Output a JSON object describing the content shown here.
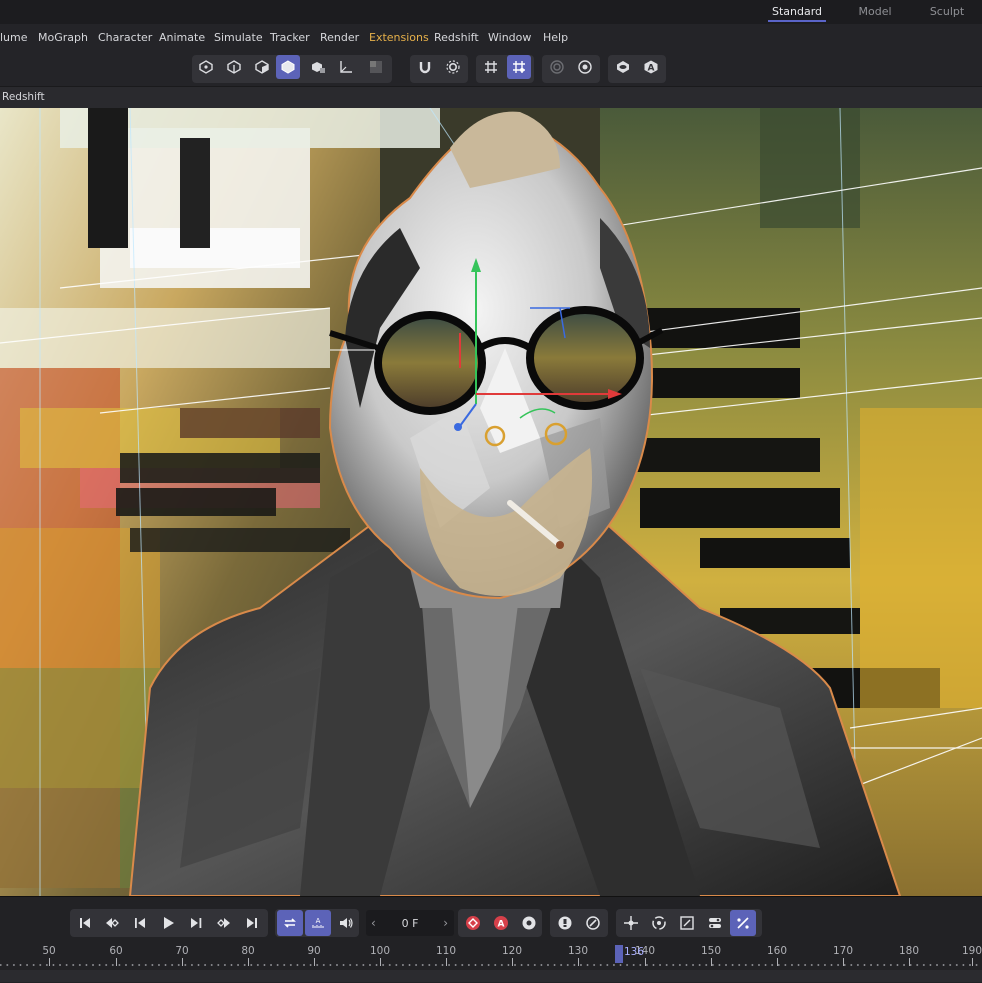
{
  "layouts": [
    "Standard",
    "Model",
    "Sculpt"
  ],
  "menu": [
    "lume",
    "MoGraph",
    "Character",
    "Animate",
    "Simulate",
    "Tracker",
    "Render",
    "Extensions",
    "Redshift",
    "Window",
    "Help"
  ],
  "toolbar_icons": [
    "null-object-icon",
    "spline-pen-icon",
    "cube-icon",
    "model-mode-icon",
    "object-mode-icon",
    "axis-icon",
    "render-region-icon",
    "magnet-icon",
    "gear-pin-icon",
    "grid-icon",
    "snap-grid-icon",
    "target-icon",
    "render-settings-icon",
    "eye-icon",
    "text-a-icon"
  ],
  "viewport": {
    "label": "Redshift"
  },
  "timeline": {
    "frame_value": "0 F",
    "ruler_ticks": [
      "50",
      "60",
      "70",
      "80",
      "90",
      "100",
      "110",
      "120",
      "130",
      "140",
      "150",
      "160",
      "170",
      "180",
      "190"
    ],
    "current_frame": "136",
    "buttons": [
      "go-to-start-icon",
      "prev-key-icon",
      "prev-frame-icon",
      "play-icon",
      "next-frame-icon",
      "next-key-icon",
      "go-to-end-icon",
      "loop-icon",
      "sequence-icon",
      "sound-icon"
    ],
    "record_buttons": [
      "record-icon",
      "autokey-icon",
      "keyframe-settings-icon"
    ],
    "right_buttons": [
      "keyframe-icon",
      "keyframe-selection-icon",
      "move-key-icon",
      "rotate-key-icon",
      "scale-key-icon",
      "param-key-icon",
      "pla-key-icon"
    ]
  },
  "colors": {
    "accent": "#5c63b8",
    "extensions": "#e6b04a",
    "outline": "#d98a4a"
  }
}
